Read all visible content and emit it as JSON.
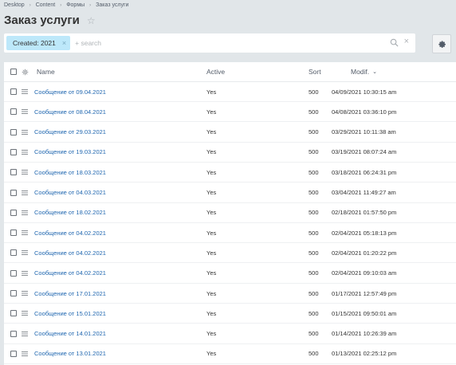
{
  "breadcrumb": [
    {
      "label": "Desktop"
    },
    {
      "label": "Content"
    },
    {
      "label": "Формы"
    },
    {
      "label": "Заказ услуги"
    }
  ],
  "page_title": "Заказ услуги",
  "filter": {
    "chip_label": "Created: 2021",
    "search_placeholder": "+ search"
  },
  "table": {
    "columns": {
      "name": "Name",
      "active": "Active",
      "sort": "Sort",
      "modified": "Modif."
    },
    "rows": [
      {
        "name": "Сообщение от 09.04.2021",
        "active": "Yes",
        "sort": "500",
        "modified": "04/09/2021 10:30:15 am"
      },
      {
        "name": "Сообщение от 08.04.2021",
        "active": "Yes",
        "sort": "500",
        "modified": "04/08/2021 03:36:10 pm"
      },
      {
        "name": "Сообщение от 29.03.2021",
        "active": "Yes",
        "sort": "500",
        "modified": "03/29/2021 10:11:38 am"
      },
      {
        "name": "Сообщение от 19.03.2021",
        "active": "Yes",
        "sort": "500",
        "modified": "03/19/2021 08:07:24 am"
      },
      {
        "name": "Сообщение от 18.03.2021",
        "active": "Yes",
        "sort": "500",
        "modified": "03/18/2021 06:24:31 pm"
      },
      {
        "name": "Сообщение от 04.03.2021",
        "active": "Yes",
        "sort": "500",
        "modified": "03/04/2021 11:49:27 am"
      },
      {
        "name": "Сообщение от 18.02.2021",
        "active": "Yes",
        "sort": "500",
        "modified": "02/18/2021 01:57:50 pm"
      },
      {
        "name": "Сообщение от 04.02.2021",
        "active": "Yes",
        "sort": "500",
        "modified": "02/04/2021 05:18:13 pm"
      },
      {
        "name": "Сообщение от 04.02.2021",
        "active": "Yes",
        "sort": "500",
        "modified": "02/04/2021 01:20:22 pm"
      },
      {
        "name": "Сообщение от 04.02.2021",
        "active": "Yes",
        "sort": "500",
        "modified": "02/04/2021 09:10:03 am"
      },
      {
        "name": "Сообщение от 17.01.2021",
        "active": "Yes",
        "sort": "500",
        "modified": "01/17/2021 12:57:49 pm"
      },
      {
        "name": "Сообщение от 15.01.2021",
        "active": "Yes",
        "sort": "500",
        "modified": "01/15/2021 09:50:01 am"
      },
      {
        "name": "Сообщение от 14.01.2021",
        "active": "Yes",
        "sort": "500",
        "modified": "01/14/2021 10:26:39 am"
      },
      {
        "name": "Сообщение от 13.01.2021",
        "active": "Yes",
        "sort": "500",
        "modified": "01/13/2021 02:25:12 pm"
      }
    ]
  }
}
